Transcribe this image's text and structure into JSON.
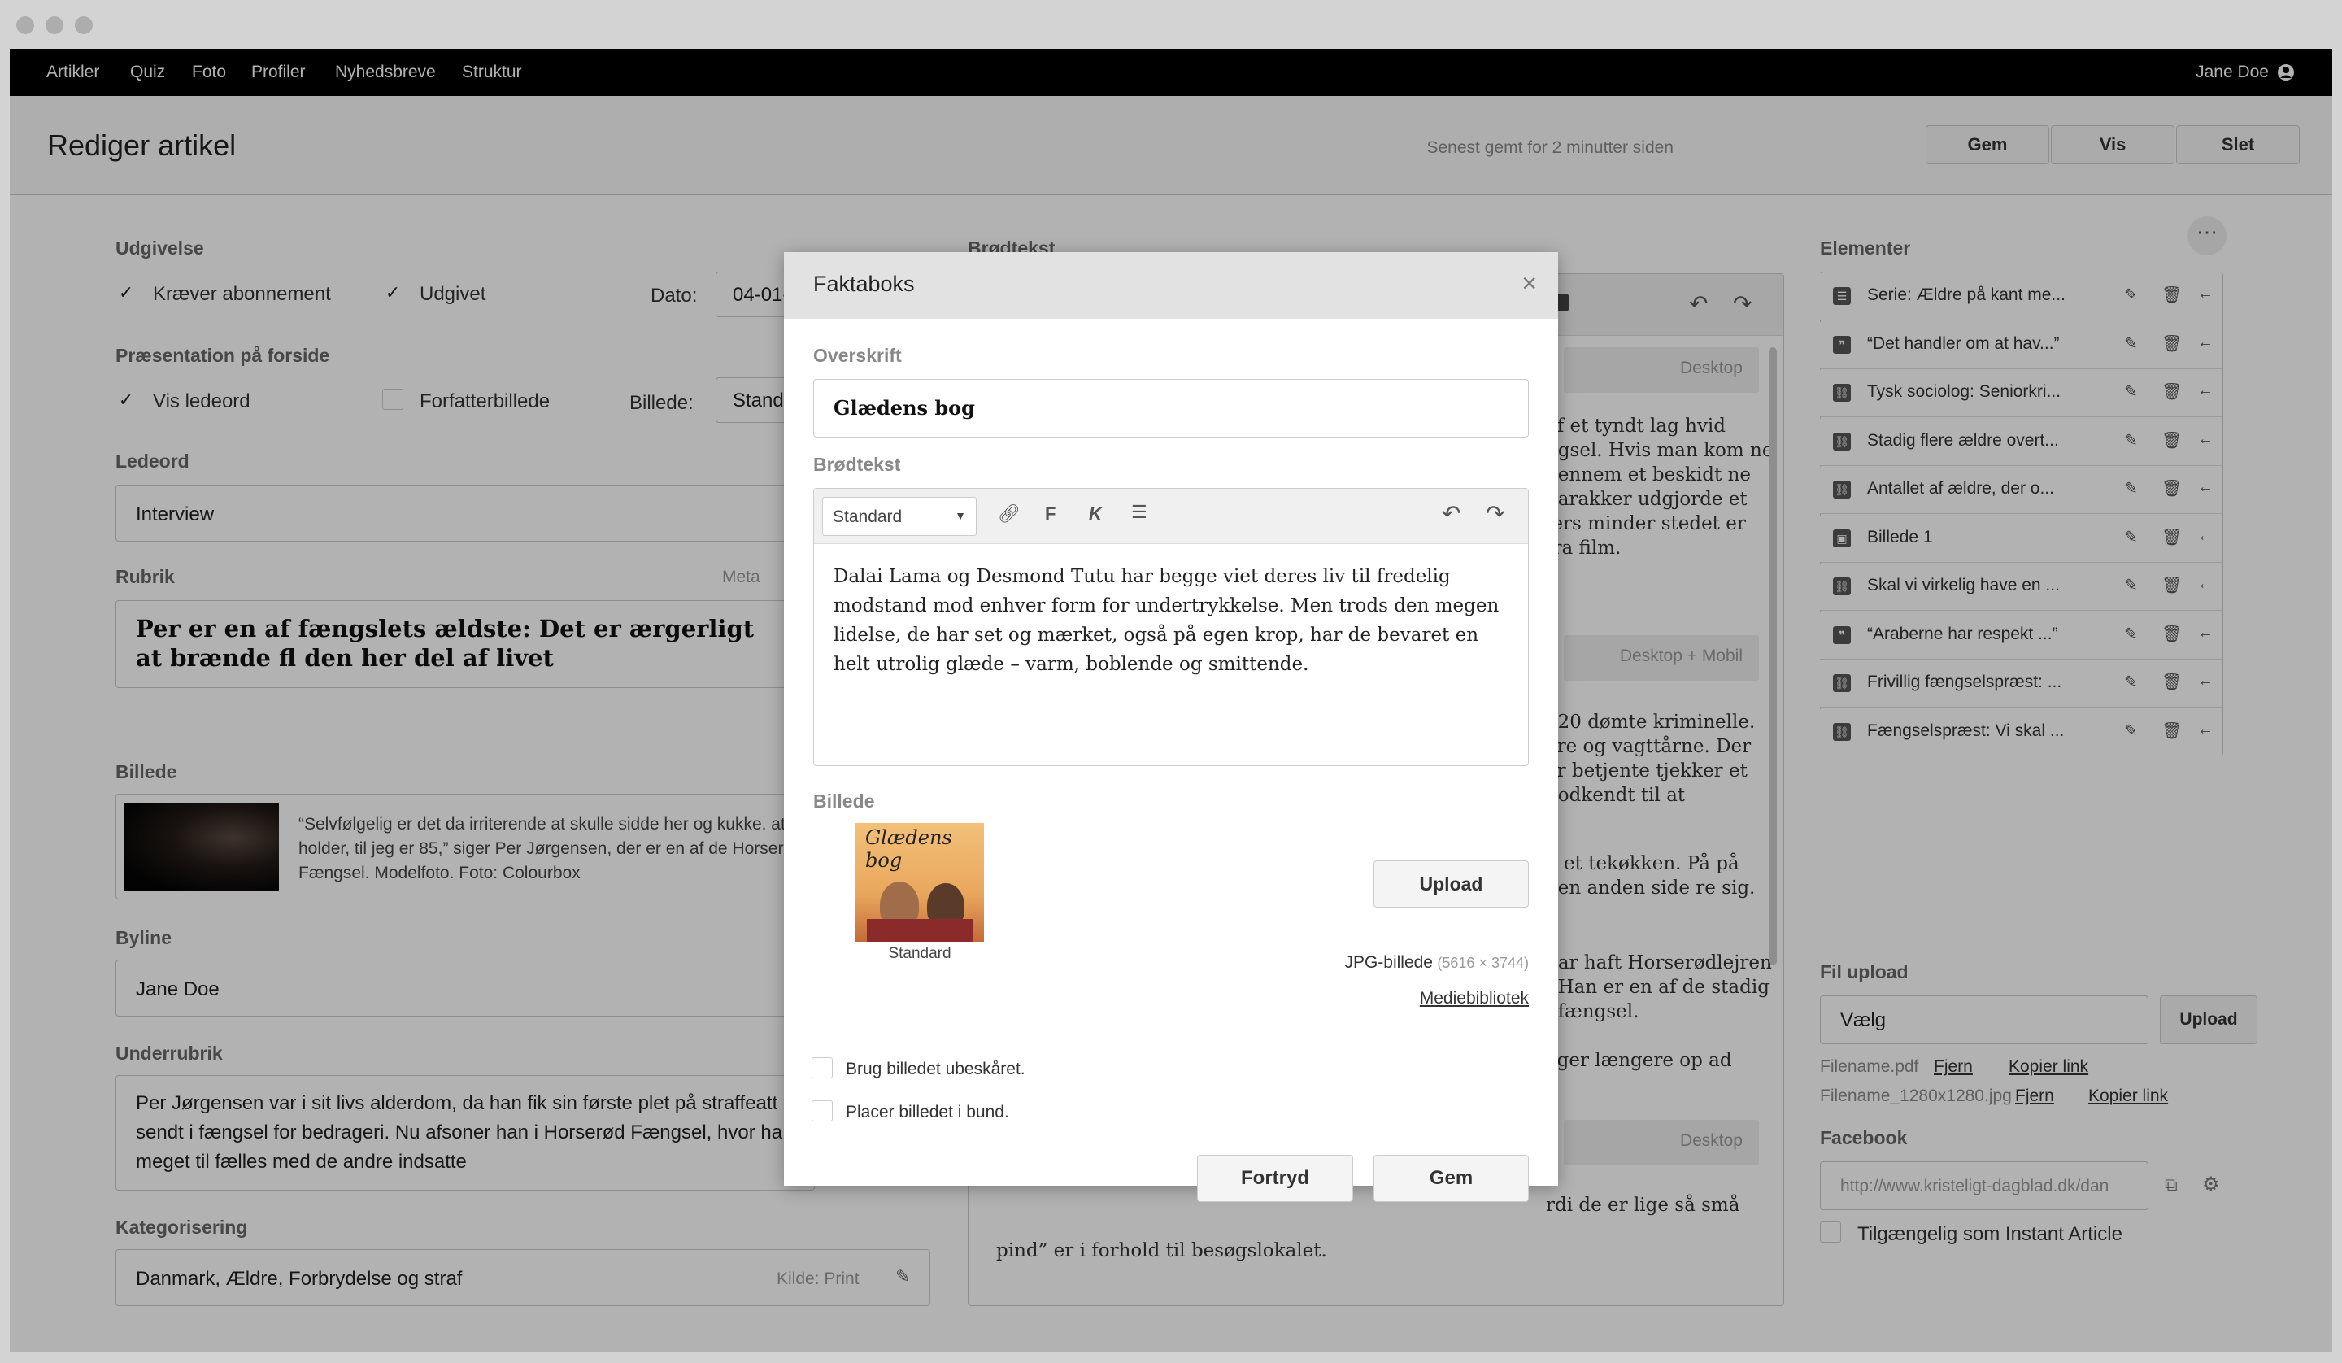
{
  "nav": {
    "items": [
      "Artikler",
      "Quiz",
      "Foto",
      "Profiler",
      "Nyhedsbreve",
      "Struktur"
    ],
    "user": "Jane Doe"
  },
  "header": {
    "title": "Rediger artikel",
    "saved": "Senest gemt for 2 minutter siden",
    "save": "Gem",
    "view": "Vis",
    "delete": "Slet"
  },
  "left": {
    "udgivelse": "Udgivelse",
    "kraever": "Kræver abonnement",
    "udgivet": "Udgivet",
    "dato_label": "Dato:",
    "dato_value": "04-01-",
    "praesentation": "Præsentation på forside",
    "vis_ledeord": "Vis ledeord",
    "forfatterbillede": "Forfatterbillede",
    "billede_label": "Billede:",
    "billede_value": "Stand",
    "ledeord": "Ledeord",
    "ledeord_value": "Interview",
    "rubrik": "Rubrik",
    "meta": "Meta",
    "rubrik_value": "Per er en af fængslets ældste: Det er ærgerligt at brænde fl den her del af livet",
    "billede": "Billede",
    "caption": "“Selvfølgelig er det da irriterende at skulle sidde her og kukke. at jeg holder, til jeg er 85,” siger Per Jørgensen, der er en af de Horserød Fængsel. Modelfoto. Foto: Colourbox",
    "byline": "Byline",
    "byline_value": "Jane Doe",
    "underrubrik": "Underrubrik",
    "underrubrik_value": "Per Jørgensen var i sit livs alderdom, da han fik sin første plet på straffeatt sendt i fængsel for bedrageri. Nu afsoner han i Horserød Fængsel, hvor ha meget til fælles med de andre indsatte",
    "kategorisering": "Kategorisering",
    "kategorisering_value": "Danmark, Ældre, Forbrydelse og straf",
    "kilde": "Kilde: Print"
  },
  "middle": {
    "title": "Brødtekst",
    "desktop": "Desktop",
    "desktop_mobil": "Desktop + Mobil",
    "p1": "af et tyndt lag hvid ngsel. Hvis man kom ne gennem et beskidt ne barakker udgjorde et lers minder stedet er fra film.",
    "p2": "020 dømte kriminelle. ere og vagttårne. Der er betjente tjekker et godkendt til at",
    "p3": "g et tekøkken. På på den anden side re sig.",
    "p4": "har haft Horserødlejren . Han er en af de stadig i fængsel.",
    "p5": "eger længere op ad",
    "p6": "rdi de er lige så små",
    "p7": "pind” er i forhold til besøgslokalet."
  },
  "elements": {
    "title": "Elementer",
    "items": [
      "Serie: Ældre på kant me...",
      "“Det handler om at hav...”",
      "Tysk sociolog: Seniorkri...",
      "Stadig flere ældre overt...",
      "Antallet af ældre, der o...",
      "Billede 1",
      "Skal vi virkelig have en ...",
      "“Araberne har respekt ...”",
      "Frivillig fængselspræst: ...",
      "Fængselspræst: Vi skal ..."
    ]
  },
  "fil_upload": {
    "title": "Fil upload",
    "placeholder": "Vælg",
    "upload": "Upload",
    "file1": "Filename.pdf",
    "file2": "Filename_1280x1280.jpg",
    "remove": "Fjern",
    "copy_link": "Kopier link"
  },
  "facebook": {
    "title": "Facebook",
    "url": "http://www.kristeligt-dagblad.dk/dan",
    "instant": "Tilgængelig som Instant Article"
  },
  "modal": {
    "title": "Faktaboks",
    "overskrift_label": "Overskrift",
    "overskrift_value": "Glædens bog",
    "brodtekst_label": "Brødtekst",
    "format": "Standard",
    "body": "Dalai Lama og Desmond Tutu har begge viet deres liv til fredelig modstand mod enhver form for undertrykkelse. Men trods den megen lidelse, de har set og mærket, også på egen krop, har de bevaret en helt utrolig glæde – varm, boblende og smittende.",
    "billede_label": "Billede",
    "thumb_caption": "Standard",
    "book_title": "Glædens bog",
    "upload": "Upload",
    "file_type": "JPG-billede",
    "dimensions": "(5616 × 3744)",
    "library": "Mediebibliotek",
    "opt1": "Brug billedet ubeskåret.",
    "opt2": "Placer billedet i bund.",
    "cancel": "Fortryd",
    "save": "Gem"
  },
  "icons": [
    "check-icon",
    "user-icon",
    "close-icon",
    "link-icon",
    "bold-icon",
    "italic-icon",
    "list-icon",
    "undo-icon",
    "redo-icon",
    "edit-icon",
    "trash-icon",
    "arrow-left-icon",
    "copy-icon",
    "gear-icon",
    "more-icon"
  ]
}
